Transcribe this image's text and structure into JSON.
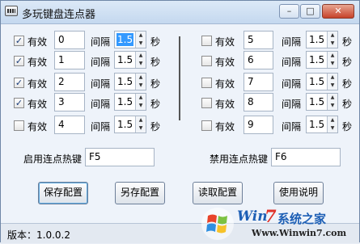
{
  "window": {
    "title": "多玩键盘连点器"
  },
  "labels": {
    "valid": "有效",
    "interval": "间隔",
    "seconds": "秒"
  },
  "rows_left": [
    {
      "checked": true,
      "key": "0",
      "interval": "1.5",
      "selected": true
    },
    {
      "checked": true,
      "key": "1",
      "interval": "1.5",
      "selected": false
    },
    {
      "checked": true,
      "key": "2",
      "interval": "1.5",
      "selected": false
    },
    {
      "checked": true,
      "key": "3",
      "interval": "1.5",
      "selected": false
    },
    {
      "checked": false,
      "key": "4",
      "interval": "1.5",
      "selected": false
    }
  ],
  "rows_right": [
    {
      "checked": false,
      "key": "5",
      "interval": "1.5"
    },
    {
      "checked": false,
      "key": "6",
      "interval": "1.5"
    },
    {
      "checked": false,
      "key": "7",
      "interval": "1.5"
    },
    {
      "checked": false,
      "key": "8",
      "interval": "1.5"
    },
    {
      "checked": false,
      "key": "9",
      "interval": "1.5"
    }
  ],
  "hotkeys": {
    "enable_label": "启用连点热键",
    "enable_value": "F5",
    "disable_label": "禁用连点热键",
    "disable_value": "F6"
  },
  "buttons": {
    "save": "保存配置",
    "save_as": "另存配置",
    "load": "读取配置",
    "help": "使用说明"
  },
  "status": {
    "version": "版本：1.0.0.2"
  },
  "watermark": {
    "brand_win": "Win",
    "brand_7": "7",
    "brand_cn": "系统之家",
    "url": "Www.Winwin7.com"
  }
}
